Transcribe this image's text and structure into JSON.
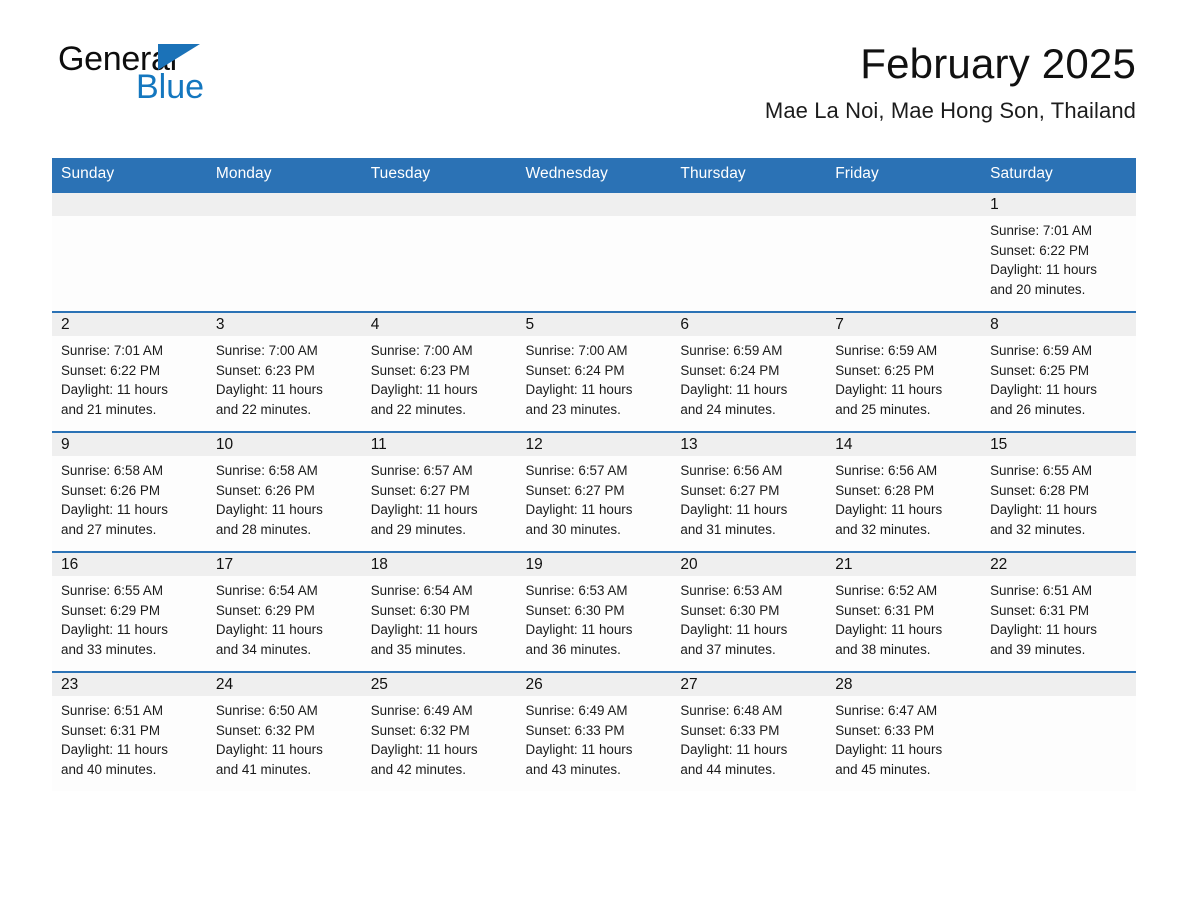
{
  "brand": {
    "name_part1": "General",
    "name_part2": "Blue",
    "triangle_color": "#1b72b8",
    "blue_text_color": "#1477bf"
  },
  "header": {
    "month_title": "February 2025",
    "location": "Mae La Noi, Mae Hong Son, Thailand",
    "header_bg_color": "#2b72b5",
    "header_text_color": "#ffffff",
    "daynum_band_color": "#efefef"
  },
  "weekday_headers": [
    "Sunday",
    "Monday",
    "Tuesday",
    "Wednesday",
    "Thursday",
    "Friday",
    "Saturday"
  ],
  "weeks": [
    [
      {
        "day": "",
        "info": "",
        "empty": true
      },
      {
        "day": "",
        "info": "",
        "empty": true
      },
      {
        "day": "",
        "info": "",
        "empty": true
      },
      {
        "day": "",
        "info": "",
        "empty": true
      },
      {
        "day": "",
        "info": "",
        "empty": true
      },
      {
        "day": "",
        "info": "",
        "empty": true
      },
      {
        "day": "1",
        "info": "Sunrise: 7:01 AM\nSunset: 6:22 PM\nDaylight: 11 hours\nand 20 minutes.",
        "empty": false
      }
    ],
    [
      {
        "day": "2",
        "info": "Sunrise: 7:01 AM\nSunset: 6:22 PM\nDaylight: 11 hours\nand 21 minutes.",
        "empty": false
      },
      {
        "day": "3",
        "info": "Sunrise: 7:00 AM\nSunset: 6:23 PM\nDaylight: 11 hours\nand 22 minutes.",
        "empty": false
      },
      {
        "day": "4",
        "info": "Sunrise: 7:00 AM\nSunset: 6:23 PM\nDaylight: 11 hours\nand 22 minutes.",
        "empty": false
      },
      {
        "day": "5",
        "info": "Sunrise: 7:00 AM\nSunset: 6:24 PM\nDaylight: 11 hours\nand 23 minutes.",
        "empty": false
      },
      {
        "day": "6",
        "info": "Sunrise: 6:59 AM\nSunset: 6:24 PM\nDaylight: 11 hours\nand 24 minutes.",
        "empty": false
      },
      {
        "day": "7",
        "info": "Sunrise: 6:59 AM\nSunset: 6:25 PM\nDaylight: 11 hours\nand 25 minutes.",
        "empty": false
      },
      {
        "day": "8",
        "info": "Sunrise: 6:59 AM\nSunset: 6:25 PM\nDaylight: 11 hours\nand 26 minutes.",
        "empty": false
      }
    ],
    [
      {
        "day": "9",
        "info": "Sunrise: 6:58 AM\nSunset: 6:26 PM\nDaylight: 11 hours\nand 27 minutes.",
        "empty": false
      },
      {
        "day": "10",
        "info": "Sunrise: 6:58 AM\nSunset: 6:26 PM\nDaylight: 11 hours\nand 28 minutes.",
        "empty": false
      },
      {
        "day": "11",
        "info": "Sunrise: 6:57 AM\nSunset: 6:27 PM\nDaylight: 11 hours\nand 29 minutes.",
        "empty": false
      },
      {
        "day": "12",
        "info": "Sunrise: 6:57 AM\nSunset: 6:27 PM\nDaylight: 11 hours\nand 30 minutes.",
        "empty": false
      },
      {
        "day": "13",
        "info": "Sunrise: 6:56 AM\nSunset: 6:27 PM\nDaylight: 11 hours\nand 31 minutes.",
        "empty": false
      },
      {
        "day": "14",
        "info": "Sunrise: 6:56 AM\nSunset: 6:28 PM\nDaylight: 11 hours\nand 32 minutes.",
        "empty": false
      },
      {
        "day": "15",
        "info": "Sunrise: 6:55 AM\nSunset: 6:28 PM\nDaylight: 11 hours\nand 32 minutes.",
        "empty": false
      }
    ],
    [
      {
        "day": "16",
        "info": "Sunrise: 6:55 AM\nSunset: 6:29 PM\nDaylight: 11 hours\nand 33 minutes.",
        "empty": false
      },
      {
        "day": "17",
        "info": "Sunrise: 6:54 AM\nSunset: 6:29 PM\nDaylight: 11 hours\nand 34 minutes.",
        "empty": false
      },
      {
        "day": "18",
        "info": "Sunrise: 6:54 AM\nSunset: 6:30 PM\nDaylight: 11 hours\nand 35 minutes.",
        "empty": false
      },
      {
        "day": "19",
        "info": "Sunrise: 6:53 AM\nSunset: 6:30 PM\nDaylight: 11 hours\nand 36 minutes.",
        "empty": false
      },
      {
        "day": "20",
        "info": "Sunrise: 6:53 AM\nSunset: 6:30 PM\nDaylight: 11 hours\nand 37 minutes.",
        "empty": false
      },
      {
        "day": "21",
        "info": "Sunrise: 6:52 AM\nSunset: 6:31 PM\nDaylight: 11 hours\nand 38 minutes.",
        "empty": false
      },
      {
        "day": "22",
        "info": "Sunrise: 6:51 AM\nSunset: 6:31 PM\nDaylight: 11 hours\nand 39 minutes.",
        "empty": false
      }
    ],
    [
      {
        "day": "23",
        "info": "Sunrise: 6:51 AM\nSunset: 6:31 PM\nDaylight: 11 hours\nand 40 minutes.",
        "empty": false
      },
      {
        "day": "24",
        "info": "Sunrise: 6:50 AM\nSunset: 6:32 PM\nDaylight: 11 hours\nand 41 minutes.",
        "empty": false
      },
      {
        "day": "25",
        "info": "Sunrise: 6:49 AM\nSunset: 6:32 PM\nDaylight: 11 hours\nand 42 minutes.",
        "empty": false
      },
      {
        "day": "26",
        "info": "Sunrise: 6:49 AM\nSunset: 6:33 PM\nDaylight: 11 hours\nand 43 minutes.",
        "empty": false
      },
      {
        "day": "27",
        "info": "Sunrise: 6:48 AM\nSunset: 6:33 PM\nDaylight: 11 hours\nand 44 minutes.",
        "empty": false
      },
      {
        "day": "28",
        "info": "Sunrise: 6:47 AM\nSunset: 6:33 PM\nDaylight: 11 hours\nand 45 minutes.",
        "empty": false
      },
      {
        "day": "",
        "info": "",
        "empty": true
      }
    ]
  ]
}
